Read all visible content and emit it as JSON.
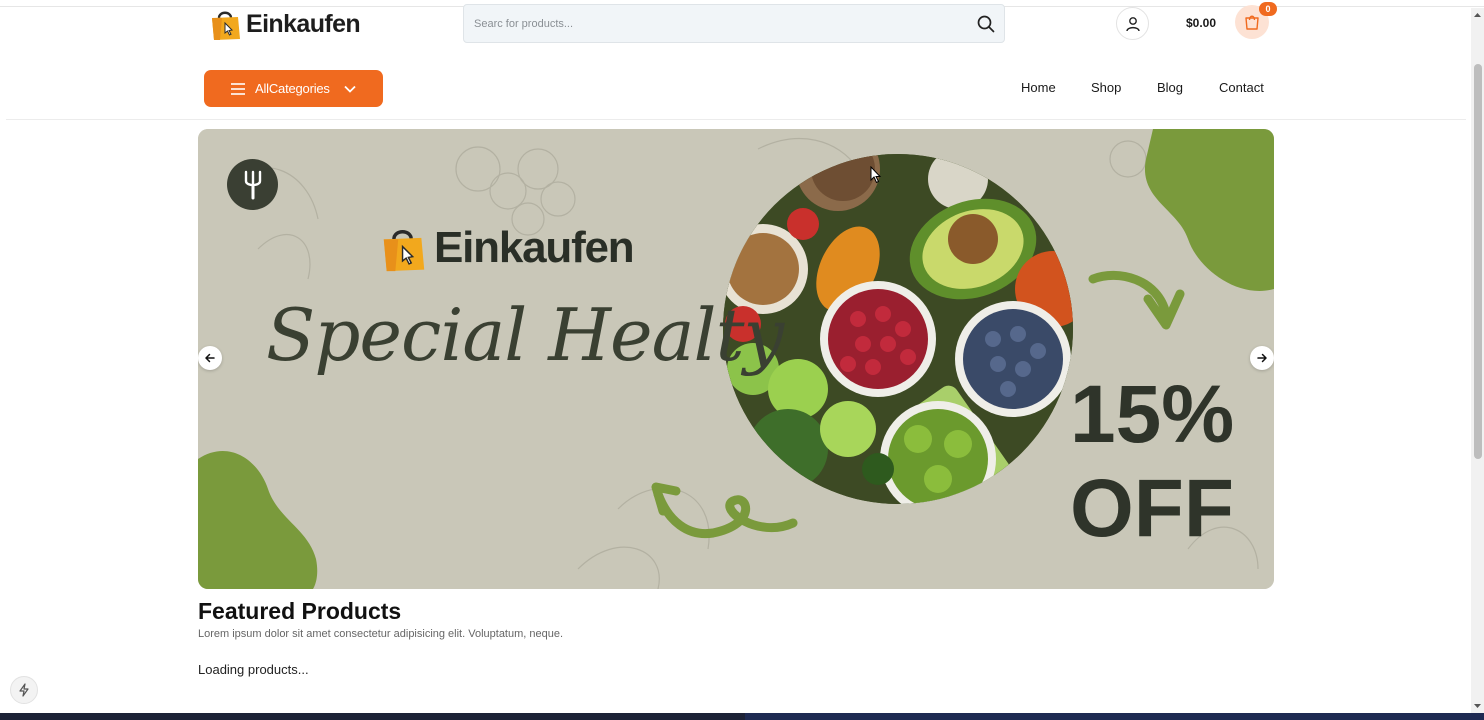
{
  "header": {
    "brand_name": "Einkaufen",
    "search_placeholder": "Searc for products...",
    "cart_total": "$0.00",
    "cart_count": "0"
  },
  "nav": {
    "categories_label": "AllCategories",
    "links": [
      "Home",
      "Shop",
      "Blog",
      "Contact"
    ]
  },
  "hero": {
    "brand_name": "Einkaufen",
    "headline": "Special Healty",
    "discount_percent": "15%",
    "discount_word": "OFF",
    "slide_prev_icon": "arrow-left-icon",
    "slide_next_icon": "arrow-right-icon"
  },
  "featured": {
    "title": "Featured Products",
    "subtitle": "Lorem ipsum dolor sit amet consectetur adipisicing elit. Voluptatum, neque.",
    "loading_text": "Loading products..."
  },
  "colors": {
    "accent": "#f06a1f",
    "hero_background": "#c9c7b8",
    "hero_green": "#7a9a3c",
    "hero_text": "#2f342a"
  },
  "icons": [
    "shopping-bag-logo-icon",
    "search-icon",
    "user-icon",
    "cart-icon",
    "menu-icon",
    "chevron-down-icon",
    "fork-icon",
    "arrow-left-icon",
    "arrow-right-icon",
    "lightning-icon"
  ]
}
